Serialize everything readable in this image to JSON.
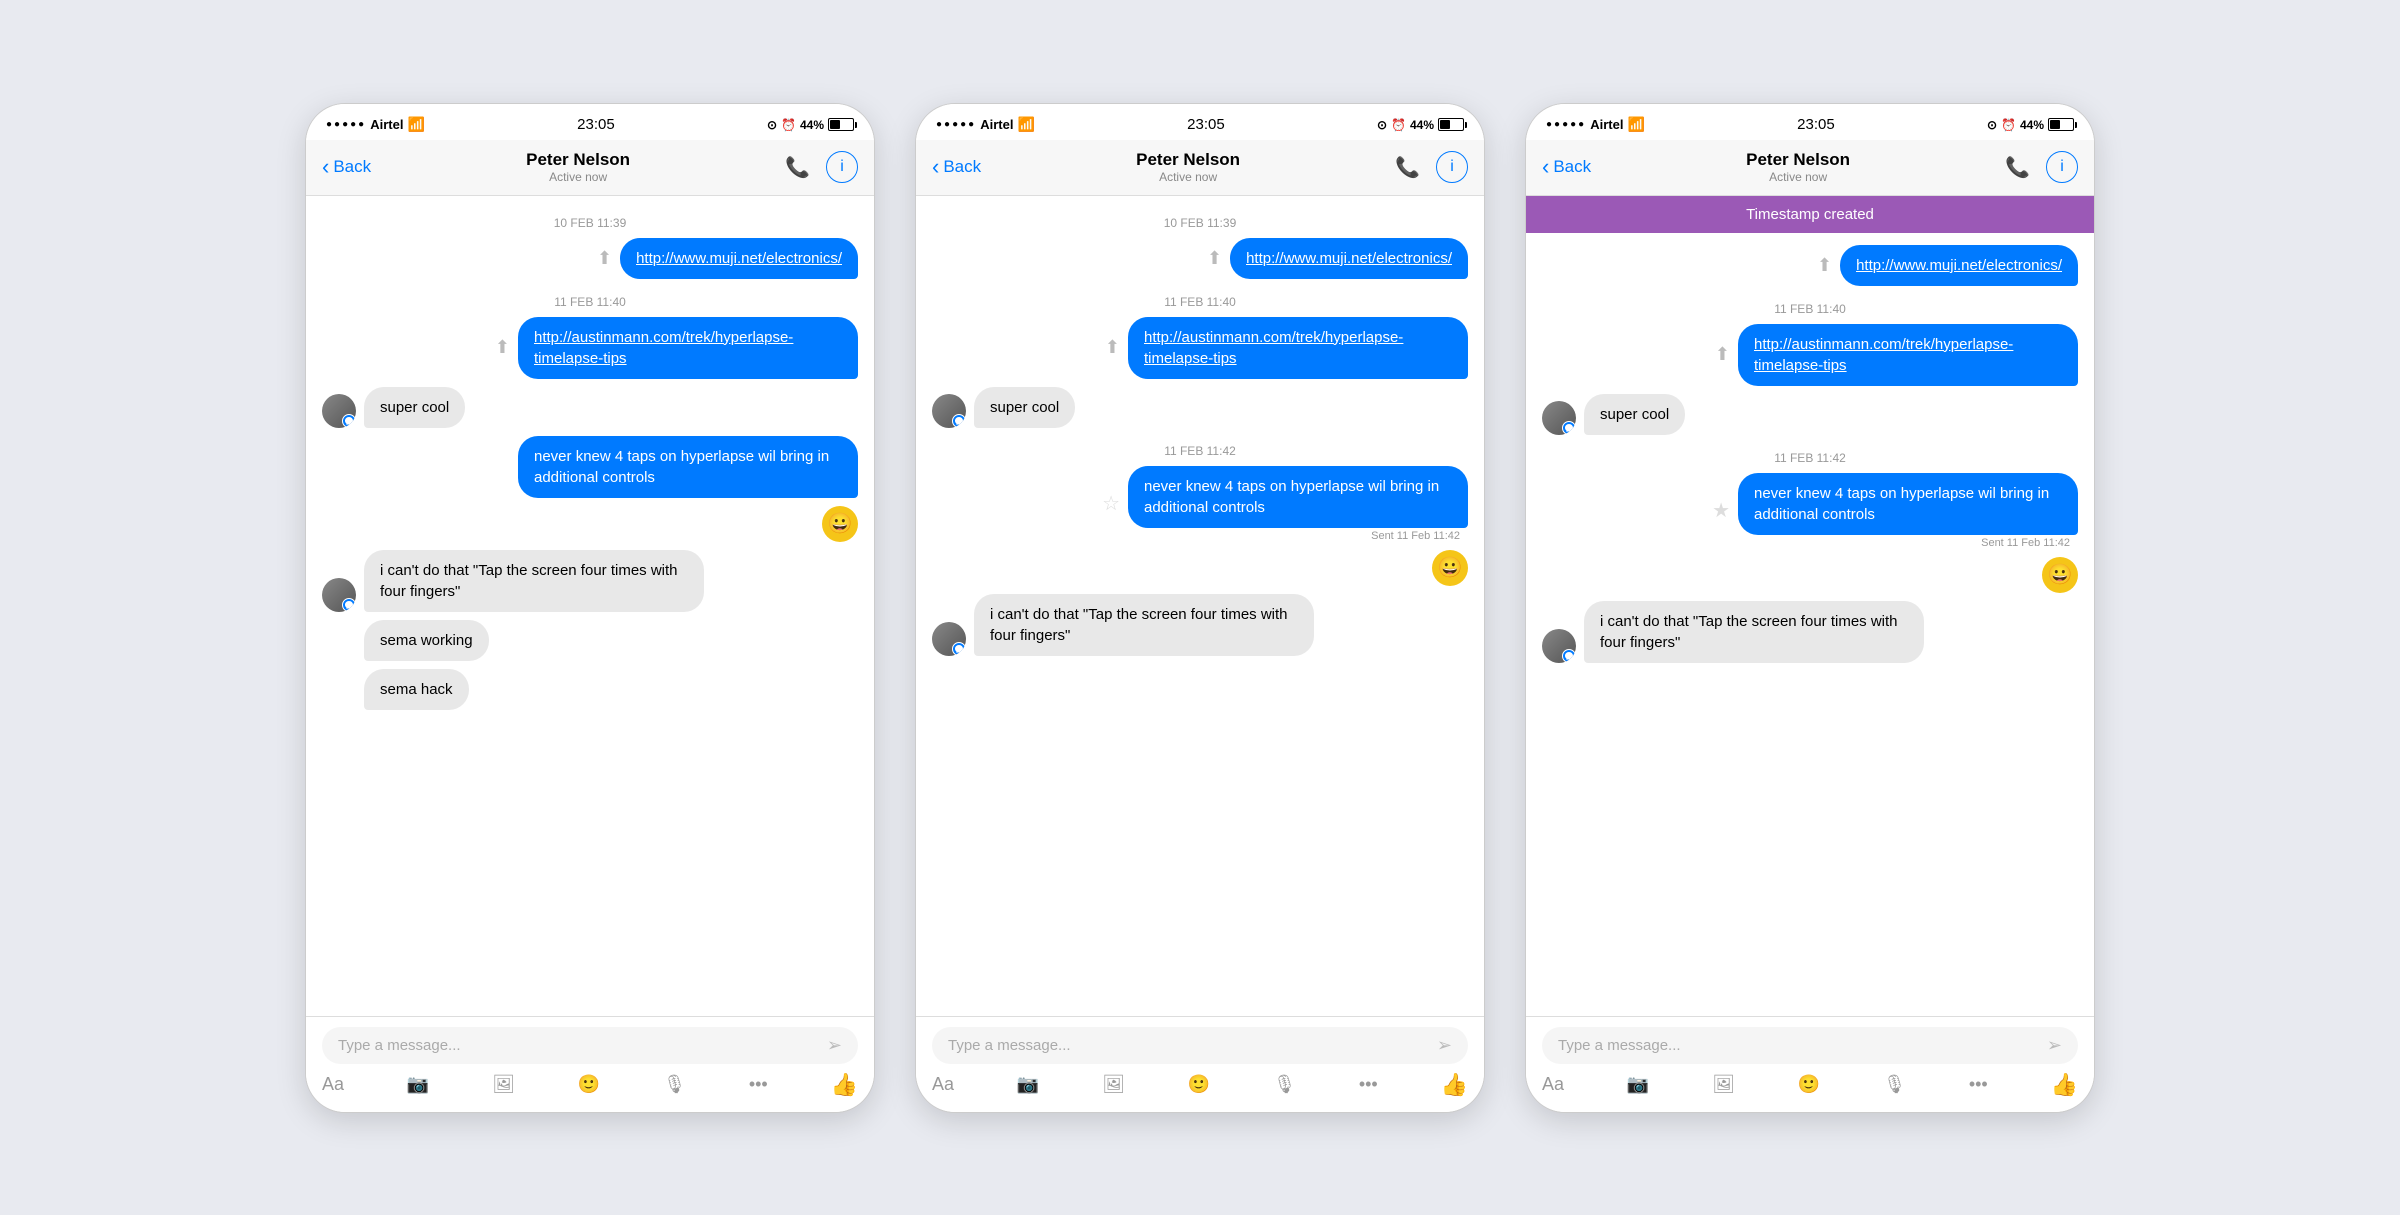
{
  "carrier": "Airtel",
  "time": "23:05",
  "battery": "44%",
  "contact": {
    "name": "Peter Nelson",
    "status": "Active now"
  },
  "back_label": "Back",
  "timestamp_banner": "Timestamp created",
  "messages": [
    {
      "type": "timestamp",
      "text": "10 FEB 11:39"
    },
    {
      "type": "outgoing",
      "text": "http://www.muji.net/electronics/",
      "link": true
    },
    {
      "type": "timestamp",
      "text": "11 FEB 11:40"
    },
    {
      "type": "outgoing",
      "text": "http://austinmann.com/trek/hyperlapse-timelapse-tips",
      "link": true
    },
    {
      "type": "incoming",
      "text": "super cool",
      "avatar": true
    },
    {
      "type": "outgoing",
      "text": "never knew 4 taps on hyperlapse wil bring in additional controls"
    },
    {
      "type": "emoji",
      "text": "😀"
    },
    {
      "type": "incoming",
      "text": "i can't do that \"Tap the screen four times with four fingers\"",
      "avatar": true
    },
    {
      "type": "incoming",
      "text": "sema working"
    },
    {
      "type": "incoming",
      "text": "sema hack"
    }
  ],
  "messages_panel2": [
    {
      "type": "timestamp",
      "text": "10 FEB 11:39"
    },
    {
      "type": "outgoing",
      "text": "http://www.muji.net/electronics/",
      "link": true
    },
    {
      "type": "timestamp",
      "text": "11 FEB 11:40"
    },
    {
      "type": "outgoing",
      "text": "http://austinmann.com/trek/hyperlapse-timelapse-tips",
      "link": true
    },
    {
      "type": "incoming",
      "text": "super cool",
      "avatar": true
    },
    {
      "type": "timestamp",
      "text": "11 FEB 11:42"
    },
    {
      "type": "outgoing_sent",
      "text": "never knew 4 taps on hyperlapse wil bring in additional controls",
      "sent": "Sent 11 Feb 11:42"
    },
    {
      "type": "emoji",
      "text": "😀"
    },
    {
      "type": "incoming",
      "text": "i can't do that \"Tap the screen four times with four fingers\"",
      "avatar": true
    }
  ],
  "input_placeholder": "Type a message...",
  "toolbar": {
    "aa": "Aa",
    "camera": "📷",
    "image": "🖼",
    "emoji": "🙂",
    "mic": "🎤",
    "more": "•••",
    "thumb": "👍"
  }
}
